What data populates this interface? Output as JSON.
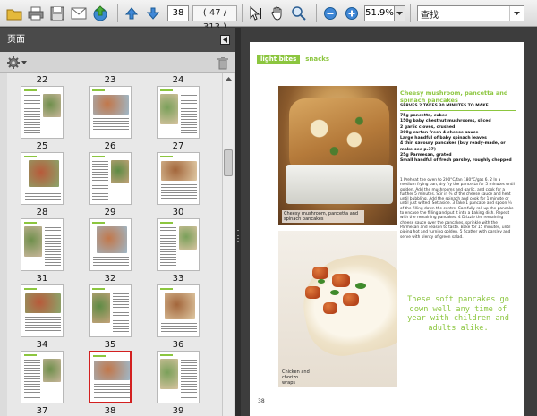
{
  "toolbar": {
    "current_page": "38",
    "page_count": "( 47 / 313 )",
    "zoom": "51.9%",
    "search_value": "查找"
  },
  "sidebar": {
    "title": "页面",
    "top_labels": [
      "22",
      "23",
      "24"
    ],
    "thumbnails": [
      {
        "label": "25"
      },
      {
        "label": "26"
      },
      {
        "label": "27"
      },
      {
        "label": "28"
      },
      {
        "label": "29"
      },
      {
        "label": "30"
      },
      {
        "label": "31"
      },
      {
        "label": "32"
      },
      {
        "label": "33"
      },
      {
        "label": "34"
      },
      {
        "label": "35"
      },
      {
        "label": "36"
      },
      {
        "label": "37"
      },
      {
        "label": "38",
        "selected": true
      },
      {
        "label": "39"
      }
    ]
  },
  "page": {
    "section_tag": "light bites",
    "section_sub": "snacks",
    "recipe_title": "Cheesy mushroom, pancetta and spinach pancakes",
    "recipe_meta": "SERVES 2 TAKES 30 MINUTES TO MAKE",
    "ingredients": [
      "75g pancetta, cubed",
      "150g baby chestnut mushrooms, sliced",
      "2 garlic cloves, crushed",
      "300g carton fresh 4-cheese sauce",
      "Large handful of baby spinach leaves",
      "4 thin savoury pancakes (buy ready-made, or make-see p.37)",
      "25g Parmesan, grated",
      "Small handful of fresh parsley, roughly chopped"
    ],
    "method": "1 Preheat the oven to 200°C/fan 180°C/gas 6. 2 In a medium frying pan, dry fry the pancetta for 5 minutes until golden. Add the mushrooms and garlic, and cook for a further 5 minutes. Stir in ¾ of the cheese sauce and heat until bubbling. Add the spinach and cook for 1 minute or until just wilted. Set aside. 3 Take 1 pancake and spoon ¼ of the filling down the centre. Carefully roll up the pancake to encase the filling and put it into a baking dish. Repeat with the remaining pancakes. 4 Drizzle the remaining cheese sauce over the pancakes, sprinkle with the Parmesan and season to taste. Bake for 15 minutes, until piping hot and turning golden. 5 Scatter with parsley and serve with plenty of green salad.",
    "caption_top": "Cheesy mushroom, pancetta and spinach pancakes",
    "caption_bottom": "Chicken and chorizo wraps",
    "pull_quote": "These soft pancakes go down well any time of year with children and adults alike.",
    "page_number": "38"
  },
  "colors": {
    "accent_green": "#8cc63f",
    "selection_red": "#d32020"
  }
}
